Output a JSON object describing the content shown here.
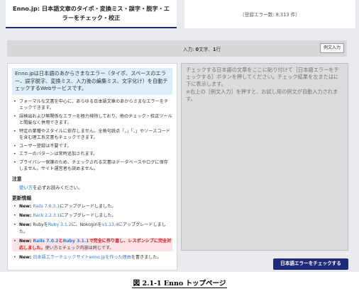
{
  "header": {
    "title": "Enno.jp: 日本語文章のタイポ・変換ミス・誤字・脱字・エラーをチェック・校正",
    "error_count": "（登録エラー数: 8,313 件）"
  },
  "status": {
    "input_prefix": "入力: ",
    "chars": "0",
    "chars_unit": "文字、",
    "lines": "1",
    "lines_unit": "行",
    "example_button": "例文入力"
  },
  "intro": "Enno.jpは日本語のあからさまなエラー（タイポ、スペースのエラー、誤字脱字、変換ミス、入力後の編集ミス、文字化け）を自動チェックするWebサービスです。",
  "features": [
    "フォーマルな文書を中心に、あらゆる日本語文章のあからさまなエラーをチェックできます。",
    "誤検出および無関係なエラーを極力排除しており、他のチェック・校正ツールと間髪なく併用できます。",
    "特定の業種やスタイルに依存しません。全角句読点「，」「．」やソースコードを含む理工系文書もチェックできます。",
    "ユーザー登録は不要です。",
    "エラーのパターンは常時追加されます。",
    "プライバシー保護のため、チェックされる文書はデータベースやログに保存しません。サイト運営者も読めません。"
  ],
  "notice": {
    "heading": "注意",
    "link": "使い方",
    "text": "を必ずお読みください。"
  },
  "updates": {
    "heading": "更新情報",
    "items": [
      {
        "new": "New: ",
        "parts": [
          {
            "t": "Rails 7.0.3.1",
            "c": "lnk"
          },
          {
            "t": "にアップグレードしました。",
            "c": ""
          }
        ]
      },
      {
        "new": "New: ",
        "parts": [
          {
            "t": "Rack 2.2.3.1",
            "c": "lnk"
          },
          {
            "t": "にアップグレードしました。",
            "c": ""
          }
        ]
      },
      {
        "new": "New: ",
        "parts": [
          {
            "t": "Rubyを",
            "c": ""
          },
          {
            "t": "Ruby 3.1.2",
            "c": "lnk"
          },
          {
            "t": "に、Nokogiriを",
            "c": ""
          },
          {
            "t": "v1.13.4",
            "c": "lnk"
          },
          {
            "t": "にアップグレードしました。",
            "c": ""
          }
        ]
      },
      {
        "new": "New: ",
        "hl": true,
        "parts": [
          {
            "t": "Rails 7.0.2",
            "c": "lnk"
          },
          {
            "t": "と",
            "c": "red"
          },
          {
            "t": "Ruby 3.1.1",
            "c": "lnk"
          },
          {
            "t": "で完全に作り直し、レスポンシブに完全対応しました。",
            "c": "red"
          },
          {
            "t": "使い方とチェック内容は同じです。",
            "c": ""
          }
        ]
      },
      {
        "new": "New: ",
        "parts": [
          {
            "t": "日本語エラーチェックサイトenno.jpを作った理由",
            "c": "lnk"
          },
          {
            "t": "を書きました。",
            "c": ""
          }
        ]
      }
    ]
  },
  "editor": {
    "placeholder": "チェックする日本語の文章をここに貼り付けて［日本語エラーをチェックする］ボタンを押してください。チェック結果を左またはに下に表示します。\n※右上の［例文入力］を押すと、お試し用の例文が自動入力されます。"
  },
  "check_button": "日本語エラーをチェックする",
  "caption": "図 2.1-1 Enno トップページ"
}
